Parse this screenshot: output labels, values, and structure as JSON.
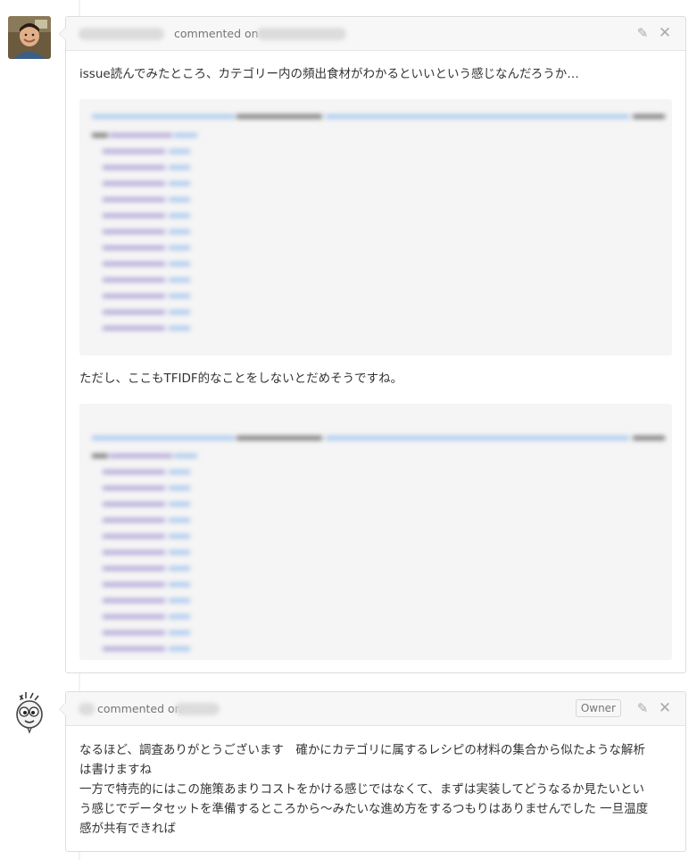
{
  "comments": [
    {
      "commented_on": "commented on",
      "body_line_1": "issue読んでみたところ、カテゴリー内の頻出食材がわかるといいという感じなんだろうか…",
      "body_line_2": "ただし、ここもTFIDF的なことをしないとだめそうですね。",
      "icons": [
        "pencil-icon",
        "close-icon"
      ]
    },
    {
      "commented_on": "commented on",
      "owner_badge": "Owner",
      "body_lines": [
        "なるほど、調査ありがとうございます　確かにカテゴリに属するレシピの材料の集合から似たような解析",
        "は書けますね",
        "一方で特売的にはこの施策あまりコストをかける感じではなくて、まずは実装してどうなるか見たいとい",
        "う感じでデータセットを準備するところから〜みたいな進め方をするつもりはありませんでした 一旦温度",
        "感が共有できれば"
      ],
      "icons": [
        "pencil-icon",
        "close-icon"
      ]
    }
  ],
  "colors": {
    "card_border": "#dddddd",
    "header_bg": "#f7f7f7",
    "code_bg": "#f5f5f5",
    "blur_blue": "#a9c9ee",
    "blur_purple": "#b4a9d8",
    "blur_dark": "#7a7a7a"
  }
}
